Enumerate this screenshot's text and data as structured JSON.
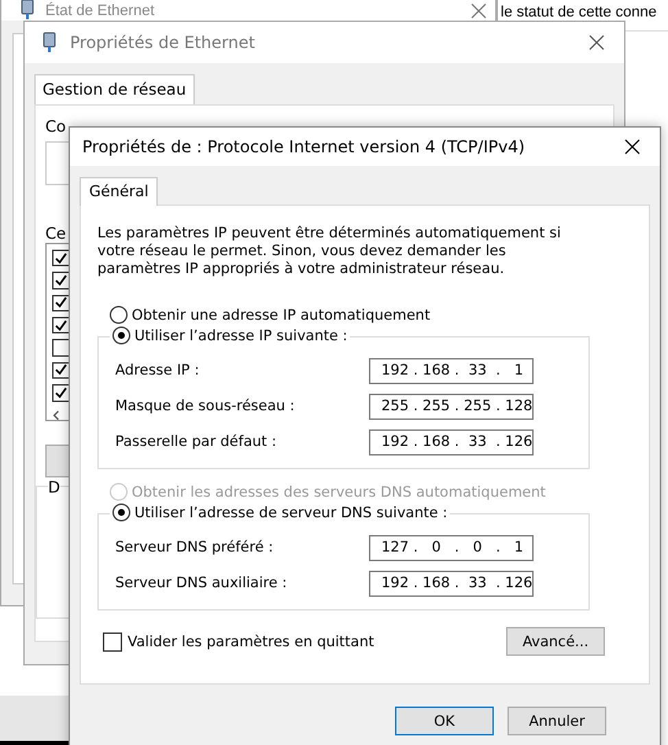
{
  "background_window": {
    "title": "État de Ethernet"
  },
  "far_window": {
    "text": "le statut de cette conne"
  },
  "ethernet_window": {
    "title": "Propriétés de Ethernet",
    "tabs": [
      {
        "label": "Gestion de réseau",
        "selected": true
      }
    ],
    "label_1": "Co",
    "label_2": "Ce",
    "label_3": "D",
    "components": [
      {
        "checked": true
      },
      {
        "checked": true
      },
      {
        "checked": true
      },
      {
        "checked": true
      },
      {
        "checked": false
      },
      {
        "checked": true
      },
      {
        "checked": true
      }
    ]
  },
  "dialog": {
    "title": "Propriétés de : Protocole Internet version 4 (TCP/IPv4)",
    "tabs": [
      {
        "label": "Général",
        "selected": true
      }
    ],
    "description": "Les paramètres IP peuvent être déterminés automatiquement si votre réseau le permet. Sinon, vous devez demander les paramètres IP appropriés à votre administrateur réseau.",
    "ip_options": [
      {
        "label": "Obtenir une adresse IP automatiquement",
        "selected": false,
        "disabled": false
      },
      {
        "label": "Utiliser l’adresse IP suivante :",
        "selected": true,
        "disabled": false
      }
    ],
    "ip_fields": [
      {
        "label": "Adresse IP :",
        "value": "192 . 168 .  33  .   1"
      },
      {
        "label": "Masque de sous-réseau :",
        "value": "255 . 255 . 255 . 128"
      },
      {
        "label": "Passerelle par défaut :",
        "value": "192 . 168 .  33  . 126"
      }
    ],
    "dns_options": [
      {
        "label": "Obtenir les adresses des serveurs DNS automatiquement",
        "selected": false,
        "disabled": true
      },
      {
        "label": "Utiliser l’adresse de serveur DNS suivante :",
        "selected": true,
        "disabled": false
      }
    ],
    "dns_fields": [
      {
        "label": "Serveur DNS préféré :",
        "value": "127 .   0   .   0   .   1"
      },
      {
        "label": "Serveur DNS auxiliaire :",
        "value": "192 . 168 .  33  . 126"
      }
    ],
    "validate": {
      "label": "Valider les paramètres en quittant",
      "checked": false
    },
    "advanced_button": "Avancé...",
    "buttons": [
      "OK",
      "Annuler"
    ]
  }
}
